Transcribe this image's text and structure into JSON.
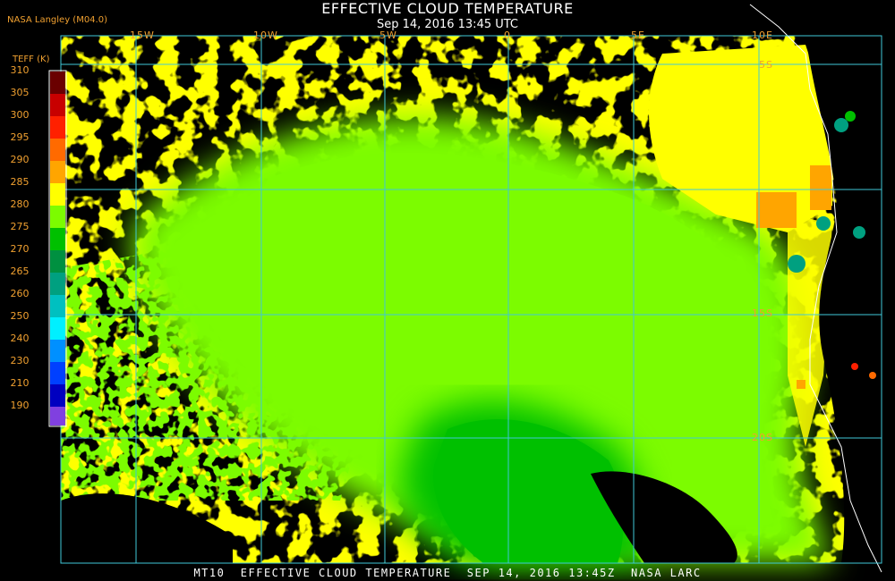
{
  "title": "EFFECTIVE CLOUD TEMPERATURE",
  "subtitle": "Sep 14, 2016 13:45 UTC",
  "source": "NASA Langley (M04.0)",
  "footer": "MT10  EFFECTIVE CLOUD TEMPERATURE  SEP 14, 2016 13:45Z  NASA LARC",
  "colorbar": {
    "title": "TEFF (K)",
    "ticks": [
      "310",
      "305",
      "300",
      "295",
      "290",
      "285",
      "280",
      "275",
      "270",
      "265",
      "260",
      "250",
      "240",
      "230",
      "210",
      "190"
    ],
    "colors": [
      "#6a0000",
      "#c80000",
      "#ff2000",
      "#ff6a00",
      "#ffa500",
      "#ffff00",
      "#7cfc00",
      "#00c000",
      "#009040",
      "#00a080",
      "#00c0c0",
      "#00f0ff",
      "#0090ff",
      "#0040ff",
      "#0000c0",
      "#8040e0"
    ]
  },
  "gridlines": {
    "longitude_labels": [
      "15W",
      "10W",
      "5W",
      "0",
      "5E",
      "10E"
    ],
    "latitude_labels": [
      "5S",
      "15S",
      "20S"
    ]
  },
  "legend_colors": {
    "clear": "#000000",
    "gridline": "#40c8d8",
    "label": "#f0a030"
  }
}
